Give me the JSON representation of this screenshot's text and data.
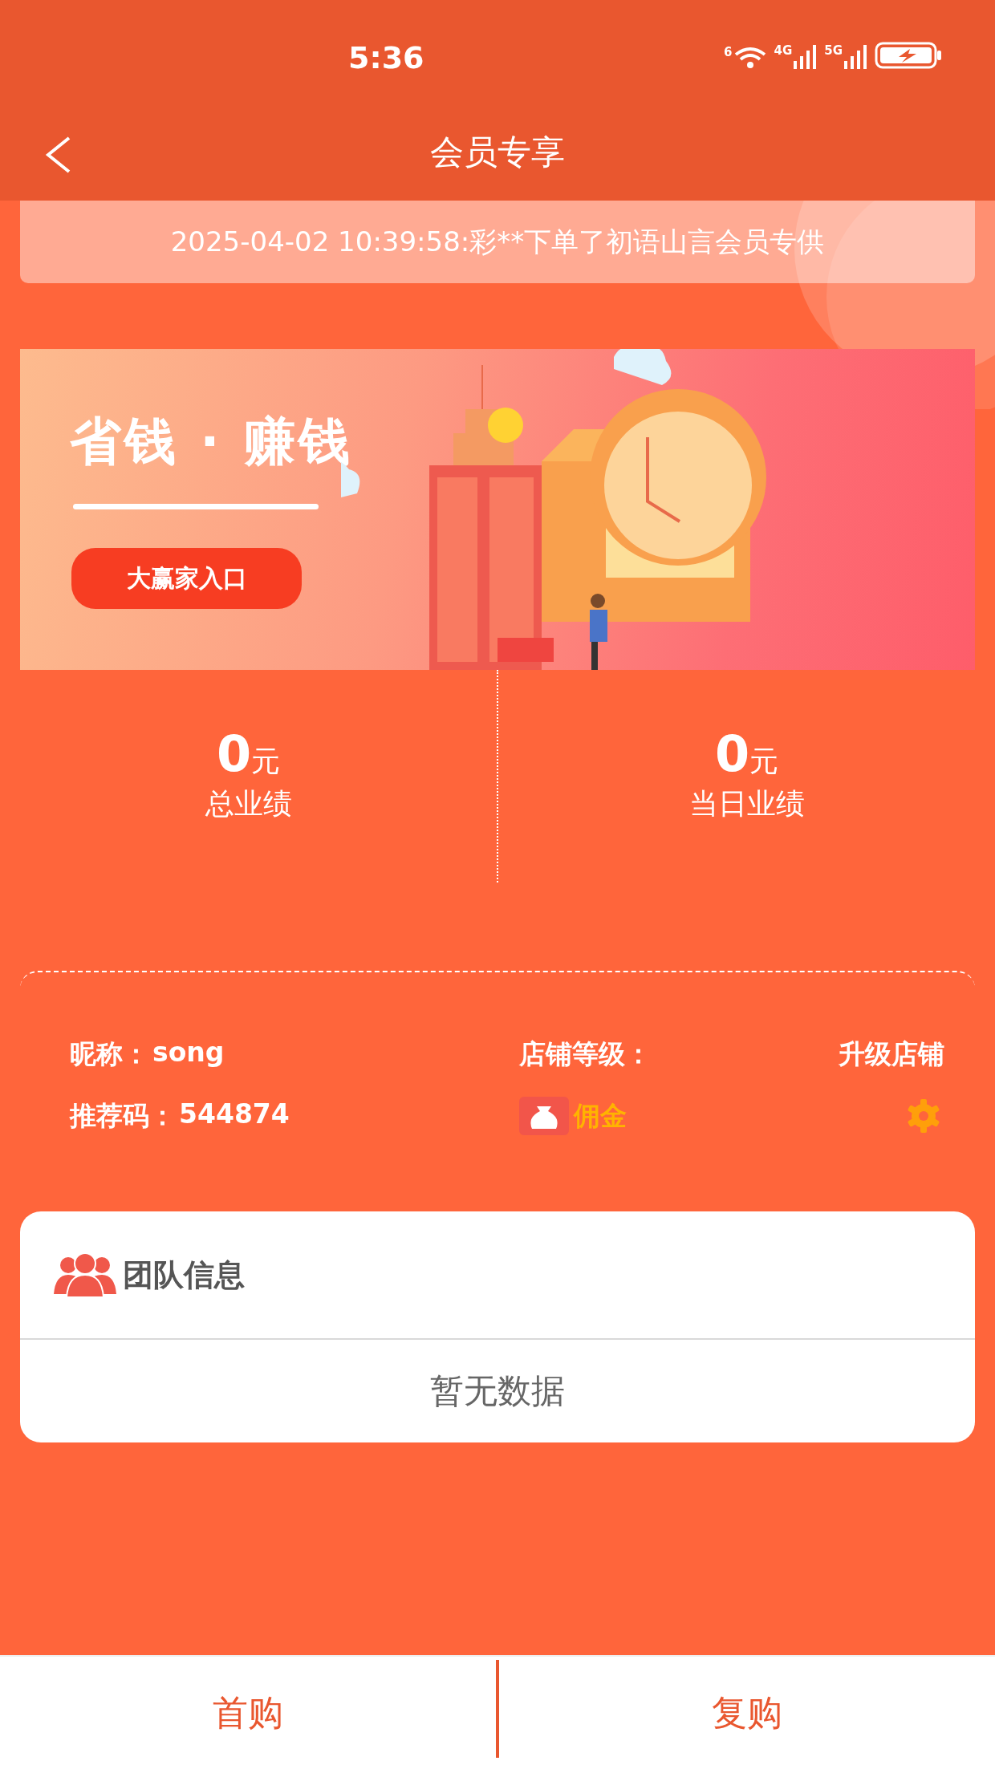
{
  "status_bar": {
    "time": "5:36",
    "wifi_label": "6",
    "networks": [
      "4G",
      "5G"
    ]
  },
  "header": {
    "title": "会员专享"
  },
  "ticker": {
    "text": "2025-04-02 10:39:58:彩**下单了初语山言会员专供"
  },
  "banner": {
    "headline": "省钱 · 赚钱",
    "button": "大赢家入口"
  },
  "stats": [
    {
      "value": "0",
      "unit": "元",
      "label": "总业绩"
    },
    {
      "value": "0",
      "unit": "元",
      "label": "当日业绩"
    }
  ],
  "profile": {
    "nickname_label": "昵称：",
    "nickname": "song",
    "store_level_label": "店铺等级：",
    "upgrade": "升级店铺",
    "code_label": "推荐码：",
    "code": "544874",
    "commission": "佣金"
  },
  "team": {
    "title": "团队信息",
    "empty": "暂无数据"
  },
  "bottom_tabs": [
    {
      "label": "首购"
    },
    {
      "label": "复购"
    }
  ]
}
